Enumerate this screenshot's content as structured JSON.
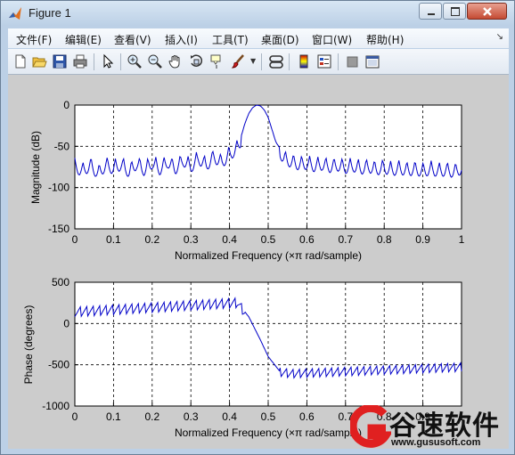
{
  "window": {
    "title": "Figure 1"
  },
  "menu": [
    {
      "label": "文件(F)"
    },
    {
      "label": "编辑(E)"
    },
    {
      "label": "查看(V)"
    },
    {
      "label": "插入(I)"
    },
    {
      "label": "工具(T)"
    },
    {
      "label": "桌面(D)"
    },
    {
      "label": "窗口(W)"
    },
    {
      "label": "帮助(H)"
    }
  ],
  "menu_overflow_icon": "double-chevron-icon",
  "toolbar": {
    "icons": [
      "new-figure-icon",
      "open-file-icon",
      "save-icon",
      "print-icon",
      "pointer-icon",
      "zoom-in-icon",
      "zoom-out-icon",
      "pan-hand-icon",
      "rotate-3d-icon",
      "data-cursor-icon",
      "brush-icon",
      "link-plot-icon",
      "colorbar-icon",
      "legend-icon",
      "hide-plot-tools-icon",
      "show-plot-tools-icon"
    ]
  },
  "watermark": {
    "brand": "谷速软件",
    "url": "www.gususoft.com"
  },
  "chart_data": [
    {
      "type": "line",
      "xlabel": "Normalized Frequency  (×π rad/sample)",
      "ylabel": "Magnitude (dB)",
      "xlim": [
        0,
        1
      ],
      "ylim": [
        -150,
        0
      ],
      "xticks": [
        "0",
        "0.1",
        "0.2",
        "0.3",
        "0.4",
        "0.5",
        "0.6",
        "0.7",
        "0.8",
        "0.9",
        "1"
      ],
      "yticks": [
        "0",
        "-50",
        "-100",
        "-150"
      ],
      "grid": true,
      "color": "#0000c8",
      "x": [
        0,
        0.02,
        0.04,
        0.06,
        0.08,
        0.1,
        0.12,
        0.14,
        0.16,
        0.18,
        0.2,
        0.22,
        0.24,
        0.26,
        0.28,
        0.3,
        0.32,
        0.34,
        0.36,
        0.38,
        0.4,
        0.42,
        0.43,
        0.44,
        0.45,
        0.46,
        0.47,
        0.48,
        0.49,
        0.5,
        0.51,
        0.52,
        0.53,
        0.54,
        0.56,
        0.58,
        0.6,
        0.62,
        0.64,
        0.66,
        0.68,
        0.7,
        0.72,
        0.74,
        0.76,
        0.78,
        0.8,
        0.82,
        0.84,
        0.86,
        0.88,
        0.9,
        0.92,
        0.94,
        0.96,
        0.98,
        1.0
      ],
      "y": [
        -70,
        -75,
        -68,
        -78,
        -68,
        -72,
        -67,
        -76,
        -66,
        -74,
        -65,
        -73,
        -64,
        -72,
        -62,
        -70,
        -60,
        -68,
        -58,
        -65,
        -55,
        -48,
        -38,
        -22,
        -10,
        -3,
        0,
        -1,
        -6,
        -15,
        -30,
        -45,
        -52,
        -60,
        -64,
        -67,
        -66,
        -69,
        -67,
        -70,
        -68,
        -71,
        -69,
        -72,
        -70,
        -73,
        -71,
        -74,
        -72,
        -74,
        -73,
        -75,
        -73,
        -75,
        -74,
        -76,
        -72
      ]
    },
    {
      "type": "line",
      "xlabel": "Normalized Frequency  (×π rad/sample)",
      "ylabel": "Phase (degrees)",
      "xlim": [
        0,
        1
      ],
      "ylim": [
        -1000,
        500
      ],
      "xticks": [
        "0",
        "0.1",
        "0.2",
        "0.3",
        "0.4",
        "0.5",
        "0.6",
        "0.7",
        "0.8",
        "0.9",
        "1"
      ],
      "yticks": [
        "500",
        "0",
        "-500",
        "-1000"
      ],
      "grid": true,
      "color": "#0000c8",
      "x": [
        0,
        0.42,
        0.45,
        0.48,
        0.5,
        0.53,
        0.56,
        1.0
      ],
      "y": [
        150,
        260,
        80,
        -200,
        -400,
        -580,
        -600,
        -520
      ]
    }
  ]
}
